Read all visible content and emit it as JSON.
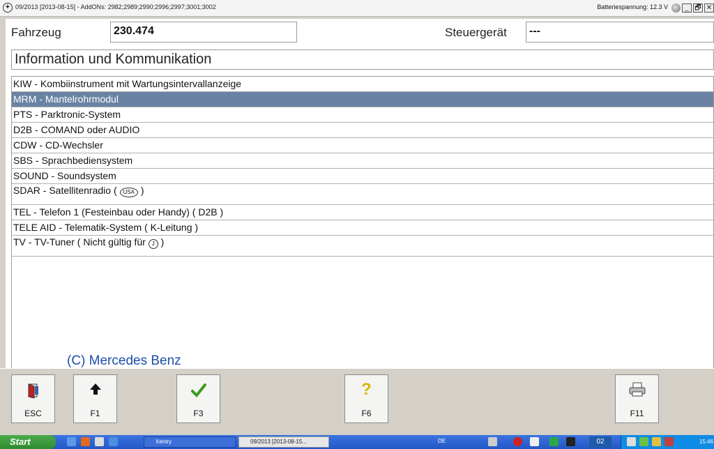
{
  "titlebar": {
    "title": "09/2013 [2013-08-15] - AddONs: 2982;2989;2990;2996;2997;3001;3002",
    "battery": "Batteriespannung: 12.3 V",
    "minimize": "_",
    "restore": "🗗",
    "close": "✕"
  },
  "header": {
    "vehicle_label": "Fahrzeug",
    "vehicle_value": "230.474",
    "ecu_label": "Steuergerät",
    "ecu_value": "---"
  },
  "section_title": "Information und Kommunikation",
  "items": [
    {
      "text": "KIW - Kombiinstrument mit Wartungsintervallanzeige"
    },
    {
      "text": "MRM - Mantelrohrmodul",
      "selected": true
    },
    {
      "text": "PTS - Parktronic-System"
    },
    {
      "text": "D2B - COMAND oder AUDIO"
    },
    {
      "text": "CDW - CD-Wechsler"
    },
    {
      "text": "SBS - Sprachbediensystem"
    },
    {
      "text": "SOUND - Soundsystem"
    },
    {
      "text": "SDAR - Satellitenradio (",
      "badge": "USA",
      "suffix": ")"
    },
    {
      "text": "TEL - Telefon 1 (Festeinbau oder Handy) ( D2B )"
    },
    {
      "text": "TELE AID - Telematik-System ( K-Leitung )"
    },
    {
      "text": "TV - TV-Tuner ( Nicht gültig für",
      "badge": "J",
      "suffix": ")"
    }
  ],
  "copyright": "(C)  Mercedes Benz",
  "buttons": [
    {
      "label": "ESC",
      "icon": "exit-door-icon"
    },
    {
      "label": "F1",
      "icon": "arrow-up-icon"
    },
    {
      "label": "F3",
      "icon": "checkmark-icon"
    },
    {
      "label": "F6",
      "icon": "help-icon"
    },
    {
      "label": "F11",
      "icon": "printer-icon"
    }
  ],
  "taskbar": {
    "start": "Start",
    "tasks": [
      "Xentry",
      "09/2013 [2013-08-15..."
    ],
    "lang": "DE",
    "tray_count": "02",
    "clock": "15:46"
  }
}
